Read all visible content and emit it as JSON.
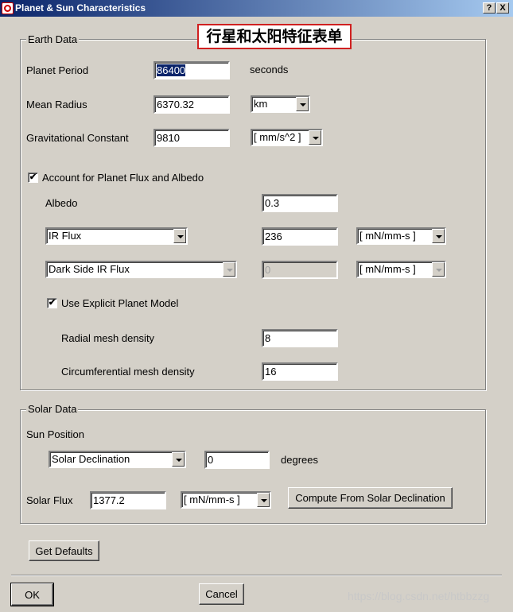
{
  "window": {
    "title": "Planet & Sun Characteristics",
    "help": "?",
    "close": "X"
  },
  "annotation": "行星和太阳特征表单",
  "earth": {
    "legend": "Earth Data",
    "period": {
      "label": "Planet Period",
      "value": "86400",
      "unit": "seconds"
    },
    "radius": {
      "label": "Mean Radius",
      "value": "6370.32",
      "unit": "km"
    },
    "grav": {
      "label": "Gravitational Constant",
      "value": "9810",
      "unit": "[ mm/s^2 ]"
    },
    "flux_check": {
      "label": "Account for Planet Flux and Albedo",
      "checked": true,
      "mark": "✔"
    },
    "albedo": {
      "label": "Albedo",
      "value": "0.3"
    },
    "ir": {
      "type": "IR Flux",
      "value": "236",
      "unit": "[ mN/mm-s ]"
    },
    "dark": {
      "type": "Dark Side IR Flux",
      "value": "0",
      "unit": "[ mN/mm-s ]"
    },
    "model_check": {
      "label": "Use Explicit Planet Model",
      "checked": true,
      "mark": "✔"
    },
    "radial": {
      "label": "Radial mesh density",
      "value": "8"
    },
    "circ": {
      "label": "Circumferential mesh density",
      "value": "16"
    }
  },
  "solar": {
    "legend": "Solar Data",
    "position_label": "Sun Position",
    "position_type": "Solar Declination",
    "position_value": "0",
    "position_unit": "degrees",
    "flux_label": "Solar Flux",
    "flux_value": "1377.2",
    "flux_unit": "[ mN/mm-s ]",
    "compute": "Compute From Solar Declination"
  },
  "buttons": {
    "defaults": "Get Defaults",
    "ok": "OK",
    "cancel": "Cancel"
  },
  "watermark": "https://blog.csdn.net/htbbzzg"
}
